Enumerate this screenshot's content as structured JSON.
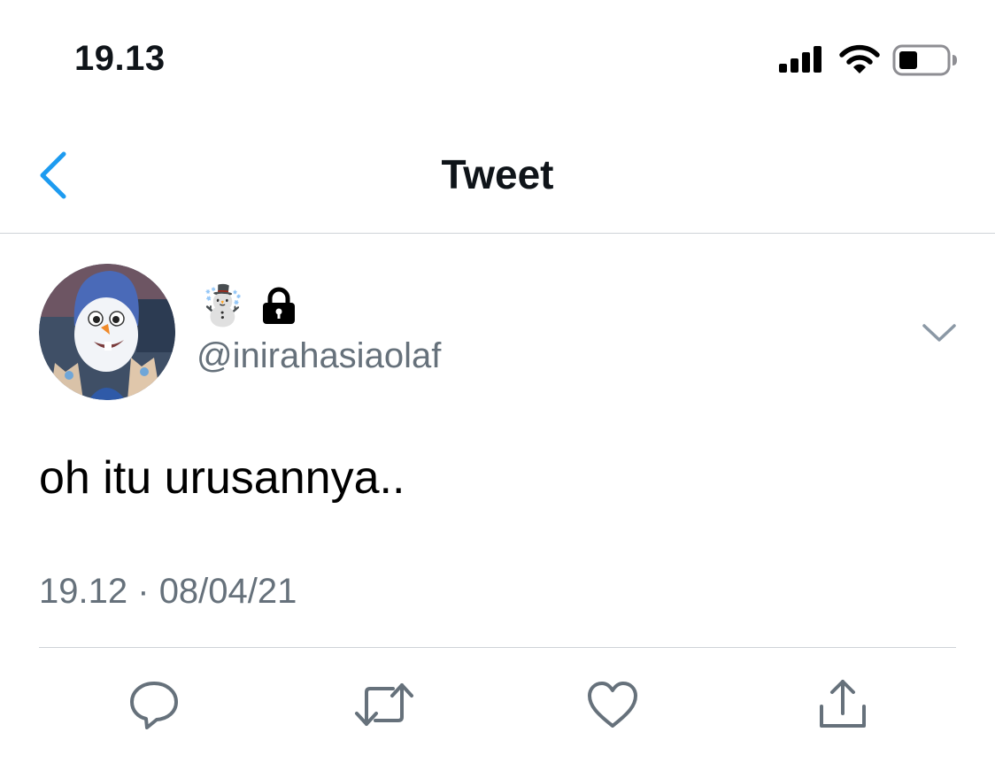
{
  "status_bar": {
    "time": "19.13"
  },
  "header": {
    "title": "Tweet"
  },
  "tweet": {
    "display_name_emoji": "☃️",
    "handle": "@inirahasiaolaf",
    "text": "oh itu urusannya..",
    "time": "19.12",
    "separator": "·",
    "date": "08/04/21"
  },
  "colors": {
    "accent": "#1d9bf0",
    "secondary_text": "#66717b",
    "divider": "#cfd3d7"
  },
  "icons": {
    "back": "chevron-left-icon",
    "more": "chevron-down-icon",
    "reply": "reply-icon",
    "retweet": "retweet-icon",
    "like": "heart-icon",
    "share": "share-icon"
  }
}
